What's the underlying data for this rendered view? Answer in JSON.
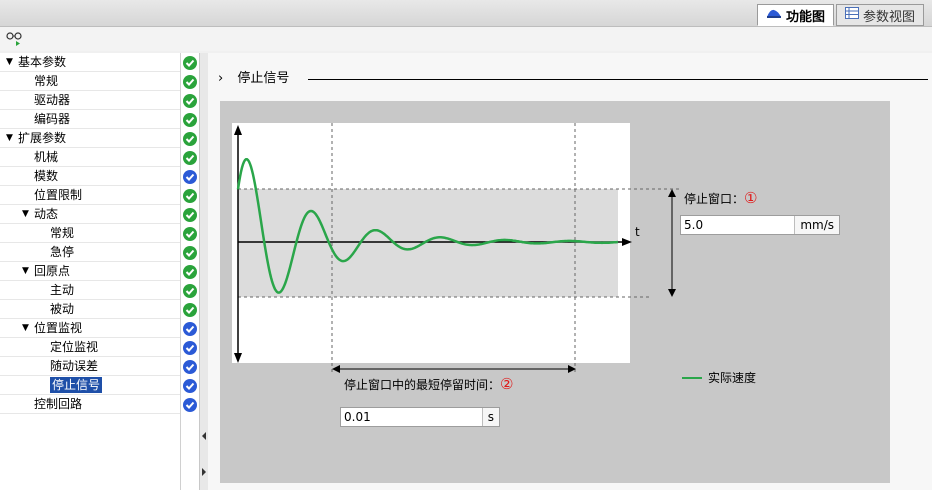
{
  "tabs": [
    {
      "label": "功能图",
      "icon": "function-view-icon",
      "active": true
    },
    {
      "label": "参数视图",
      "icon": "parameter-view-icon",
      "active": false
    }
  ],
  "tree": [
    {
      "label": "基本参数",
      "level": 0,
      "expanded": true,
      "status": "green"
    },
    {
      "label": "常规",
      "level": 1,
      "status": "green"
    },
    {
      "label": "驱动器",
      "level": 1,
      "status": "green"
    },
    {
      "label": "编码器",
      "level": 1,
      "status": "green"
    },
    {
      "label": "扩展参数",
      "level": 0,
      "expanded": true,
      "status": "green"
    },
    {
      "label": "机械",
      "level": 1,
      "status": "green"
    },
    {
      "label": "模数",
      "level": 1,
      "status": "blue"
    },
    {
      "label": "位置限制",
      "level": 1,
      "status": "green"
    },
    {
      "label": "动态",
      "level": 1,
      "expanded": true,
      "status": "green"
    },
    {
      "label": "常规",
      "level": 2,
      "status": "green"
    },
    {
      "label": "急停",
      "level": 2,
      "status": "green"
    },
    {
      "label": "回原点",
      "level": 1,
      "expanded": true,
      "status": "green"
    },
    {
      "label": "主动",
      "level": 2,
      "status": "green"
    },
    {
      "label": "被动",
      "level": 2,
      "status": "green"
    },
    {
      "label": "位置监视",
      "level": 1,
      "expanded": true,
      "status": "blue"
    },
    {
      "label": "定位监视",
      "level": 2,
      "status": "blue"
    },
    {
      "label": "随动误差",
      "level": 2,
      "status": "blue"
    },
    {
      "label": "停止信号",
      "level": 2,
      "status": "blue",
      "selected": true
    },
    {
      "label": "控制回路",
      "level": 1,
      "status": "blue"
    }
  ],
  "section": {
    "title": "停止信号"
  },
  "diagram": {
    "time_axis_label": "t",
    "stop_window_label": "停止窗口：",
    "stop_window_marker": "①",
    "stop_window_value": "5.0",
    "stop_window_unit": "mm/s",
    "min_dwell_label": "停止窗口中的最短停留时间：",
    "min_dwell_marker": "②",
    "min_dwell_value": "0.01",
    "min_dwell_unit": "s",
    "legend_label": "实际速度",
    "curve_color": "#2aa64a"
  }
}
